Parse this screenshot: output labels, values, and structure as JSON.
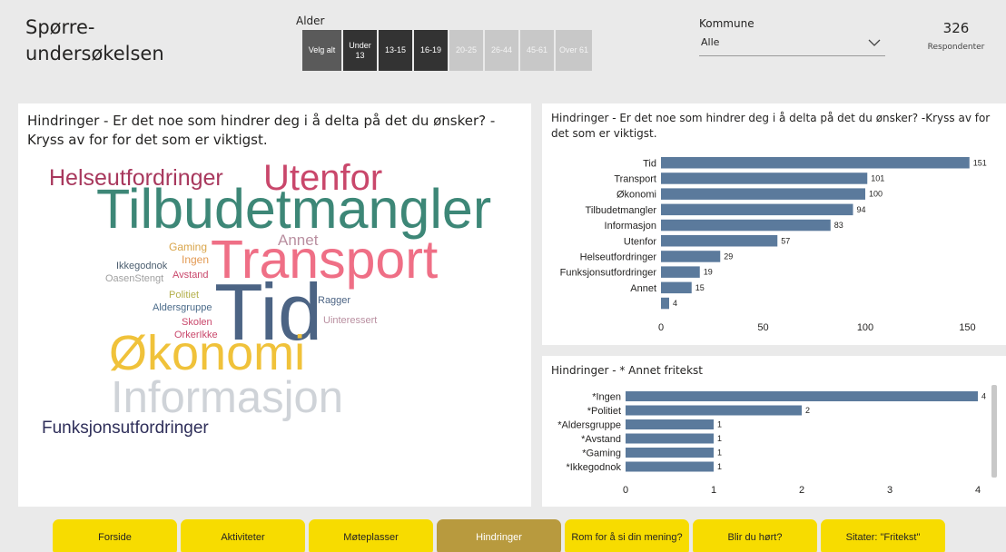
{
  "header": {
    "title": "Spørre-undersøkelsen",
    "age_label": "Alder",
    "age_buttons": [
      {
        "label": "Velg alt",
        "state": "on"
      },
      {
        "label": "Under 13",
        "state": "on"
      },
      {
        "label": "13-15",
        "state": "on"
      },
      {
        "label": "16-19",
        "state": "on"
      },
      {
        "label": "20-25",
        "state": "off"
      },
      {
        "label": "26-44",
        "state": "off"
      },
      {
        "label": "45-61",
        "state": "off"
      },
      {
        "label": "Over 61",
        "state": "off"
      }
    ],
    "kommune_label": "Kommune",
    "kommune_value": "Alle",
    "respondent_count": "326",
    "respondent_label": "Respondenter"
  },
  "wordcloud": {
    "title": "Hindringer - Er det noe som hindrer deg i å delta på det du ønsker? -Kryss av for for det som er viktigst.",
    "words": [
      {
        "text": "Helseutfordringer",
        "color": "#a8385d"
      },
      {
        "text": "Utenfor",
        "color": "#c9476b"
      },
      {
        "text": "Tilbudetmangler",
        "color": "#3d8777"
      },
      {
        "text": "Annet",
        "color": "#b98fa0"
      },
      {
        "text": "Gaming",
        "color": "#d9a54a"
      },
      {
        "text": "Ingen",
        "color": "#e39a54"
      },
      {
        "text": "Ikkegodnok",
        "color": "#4b5e6f"
      },
      {
        "text": "Avstand",
        "color": "#c9476b"
      },
      {
        "text": "OasenStengt",
        "color": "#a0a0a0"
      },
      {
        "text": "Transport",
        "color": "#ef6f86"
      },
      {
        "text": "Politiet",
        "color": "#b4b04c"
      },
      {
        "text": "Aldersgruppe",
        "color": "#4b6b8a"
      },
      {
        "text": "Skolen",
        "color": "#c9476b"
      },
      {
        "text": "OrkerIkke",
        "color": "#c9476b"
      },
      {
        "text": "Tid",
        "color": "#4c6484"
      },
      {
        "text": "Ragger",
        "color": "#4c6484"
      },
      {
        "text": "Uinteressert",
        "color": "#b98fa0"
      },
      {
        "text": "Økonomi",
        "color": "#f0c23a"
      },
      {
        "text": "Informasjon",
        "color": "#cfd3d8"
      },
      {
        "text": "Funksjonsutfordringer",
        "color": "#2f2f5a"
      }
    ]
  },
  "chart_data": [
    {
      "type": "bar",
      "orientation": "horizontal",
      "title": "Hindringer - Er det noe som hindrer deg i å delta på det du ønsker? -Kryss av for det som er viktigst.",
      "categories": [
        "Tid",
        "Transport",
        "Økonomi",
        "Tilbudetmangler",
        "Informasjon",
        "Utenfor",
        "Helseutfordringer",
        "Funksjonsutfordringer",
        "Annet",
        ""
      ],
      "values": [
        151,
        101,
        100,
        94,
        83,
        57,
        29,
        19,
        15,
        4
      ],
      "xlim": [
        0,
        160
      ],
      "xticks": [
        "0",
        "50",
        "100",
        "150"
      ],
      "bar_color": "#5b7a9c",
      "grid": false
    },
    {
      "type": "bar",
      "orientation": "horizontal",
      "title": "Hindringer - * Annet fritekst",
      "categories": [
        "*Ingen",
        "*Politiet",
        "*Aldersgruppe",
        "*Avstand",
        "*Gaming",
        "*Ikkegodnok"
      ],
      "values": [
        4,
        2,
        1,
        1,
        1,
        1
      ],
      "xlim": [
        0,
        4
      ],
      "xticks": [
        "0",
        "1",
        "2",
        "3",
        "4"
      ],
      "bar_color": "#5b7a9c",
      "grid": false
    }
  ],
  "nav": [
    {
      "label": "Forside",
      "active": false
    },
    {
      "label": "Aktiviteter",
      "active": false
    },
    {
      "label": "Møteplasser",
      "active": false
    },
    {
      "label": "Hindringer",
      "active": true
    },
    {
      "label": "Rom for å si din mening?",
      "active": false
    },
    {
      "label": "Blir du hørt?",
      "active": false
    },
    {
      "label": "Sitater: \"Fritekst\"",
      "active": false
    }
  ]
}
